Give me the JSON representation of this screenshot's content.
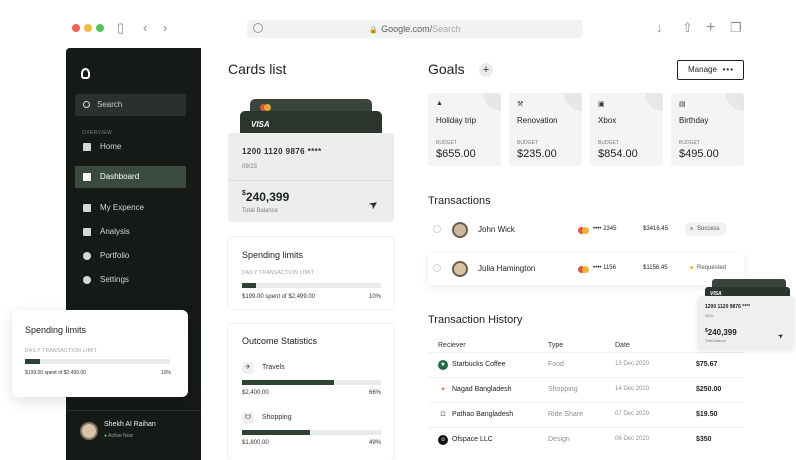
{
  "browser": {
    "url_domain": "Google.com/",
    "url_placeholder": "Search"
  },
  "sidebar": {
    "search_placeholder": "Search",
    "section_label": "OVERVIEW",
    "items": [
      {
        "label": "Home",
        "icon": "home-icon"
      },
      {
        "label": "Dashboard",
        "icon": "dashboard-icon",
        "active": true
      },
      {
        "label": "My Expence",
        "icon": "wallet-icon"
      },
      {
        "label": "Analysis",
        "icon": "chart-icon"
      },
      {
        "label": "Portfolio",
        "icon": "user-icon"
      },
      {
        "label": "Settings",
        "icon": "gear-icon"
      }
    ],
    "user": {
      "name": "Shekh Al Raihan",
      "status": "Active Now"
    }
  },
  "floating_spending": {
    "title": "Spending limits",
    "subtitle": "DAILY TRANSACTION LIMIT",
    "amount": "$199.00 spent of $2,499.00",
    "percent_text": "10%",
    "fill": 0.1
  },
  "cards": {
    "title": "Cards list",
    "card_brand": "VISA",
    "number": "1200 1120 9876 ****",
    "expiry": "09/23",
    "balance_symbol": "$",
    "balance": "240,399",
    "balance_label": "Total Balance"
  },
  "spending_limits": {
    "title": "Spending limits",
    "subtitle": "DAILY TRANSACTION LIMIT",
    "amount": "$199.00 spent of $2,499.00",
    "percent_text": "10%",
    "fill": 0.1
  },
  "outcome": {
    "title": "Outcome Statistics",
    "items": [
      {
        "name": "Travels",
        "amount": "$2,400.00",
        "percent_text": "66%",
        "fill": 0.66
      },
      {
        "name": "Shopping",
        "amount": "$1,800.00",
        "percent_text": "49%",
        "fill": 0.49
      }
    ]
  },
  "goals": {
    "title": "Goals",
    "manage_label": "Manage",
    "items": [
      {
        "name": "Holiday trip",
        "label": "BUDGET",
        "value": "$655.00",
        "icon": "mountain-icon"
      },
      {
        "name": "Renovation",
        "label": "BUDGET",
        "value": "$235.00",
        "icon": "hammer-icon"
      },
      {
        "name": "Xbox",
        "label": "BUDGET",
        "value": "$854.00",
        "icon": "gamepad-icon"
      },
      {
        "name": "Birthday",
        "label": "BUDGET",
        "value": "$495.00",
        "icon": "cake-icon"
      }
    ]
  },
  "transactions": {
    "title": "Transactions",
    "rows": [
      {
        "name": "John Wick",
        "card": "•••• 2345",
        "amount": "$3416.45",
        "status": "Success",
        "status_color": "#a9b0ab"
      },
      {
        "name": "Julia Hamington",
        "card": "•••• 1156",
        "amount": "$1156.45",
        "status": "Requested",
        "status_color": "#f2b33d"
      }
    ]
  },
  "mini_card": {
    "brand": "VISA",
    "number": "1200 1120 9876 ****",
    "expiry": "09/23",
    "balance_symbol": "$",
    "balance": "240,399",
    "balance_label": "Total Balance"
  },
  "history": {
    "title": "Transaction History",
    "headers": {
      "receiver": "Reciever",
      "type": "Type",
      "date": "Date"
    },
    "rows": [
      {
        "name": "Starbucks Coffee",
        "type": "Food",
        "date": "13 Dec 2020",
        "amount": "$75.67",
        "icon": "starbucks-icon",
        "color": "#1f6b44"
      },
      {
        "name": "Nagad Bangladesh",
        "type": "Shopping",
        "date": "14 Dec 2020",
        "amount": "$250.00",
        "icon": "nagad-icon",
        "color": "#e8523a"
      },
      {
        "name": "Pathao Bangladesh",
        "type": "Ride Share",
        "date": "07 Dec 2020",
        "amount": "$19.50",
        "icon": "pathao-icon",
        "color": "#555555"
      },
      {
        "name": "Ofspace LLC",
        "type": "Design",
        "date": "06 Dec 2020",
        "amount": "$350",
        "icon": "ofspace-icon",
        "color": "#111111"
      }
    ]
  }
}
